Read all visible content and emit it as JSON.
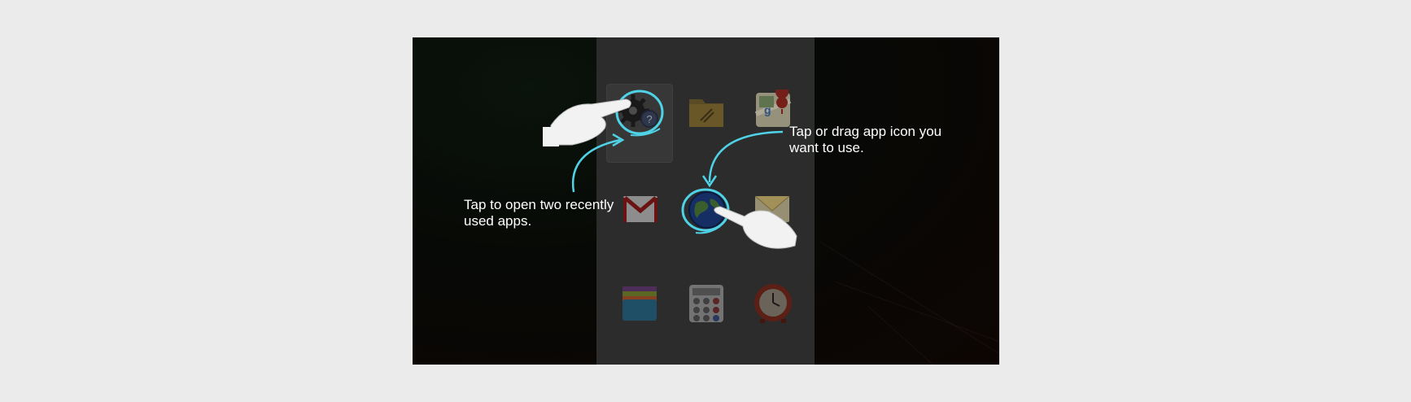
{
  "tutorial": {
    "right_instruction": "Tap or drag app icon you\nwant to use.",
    "left_instruction": "Tap to open two recently\nused apps."
  },
  "apps": [
    {
      "name": "Settings / Help",
      "icon": "settings-help-icon"
    },
    {
      "name": "My Files",
      "icon": "folder-icon"
    },
    {
      "name": "Maps",
      "icon": "maps-icon"
    },
    {
      "name": "Gmail",
      "icon": "gmail-icon"
    },
    {
      "name": "Internet",
      "icon": "globe-icon"
    },
    {
      "name": "Email",
      "icon": "email-icon"
    },
    {
      "name": "Books",
      "icon": "books-icon"
    },
    {
      "name": "Calculator",
      "icon": "calculator-icon"
    },
    {
      "name": "Clock",
      "icon": "clock-icon"
    }
  ],
  "colors": {
    "highlight": "#4fd2e6",
    "caption_text": "#ffffff",
    "panel": "#3b3b3b"
  }
}
